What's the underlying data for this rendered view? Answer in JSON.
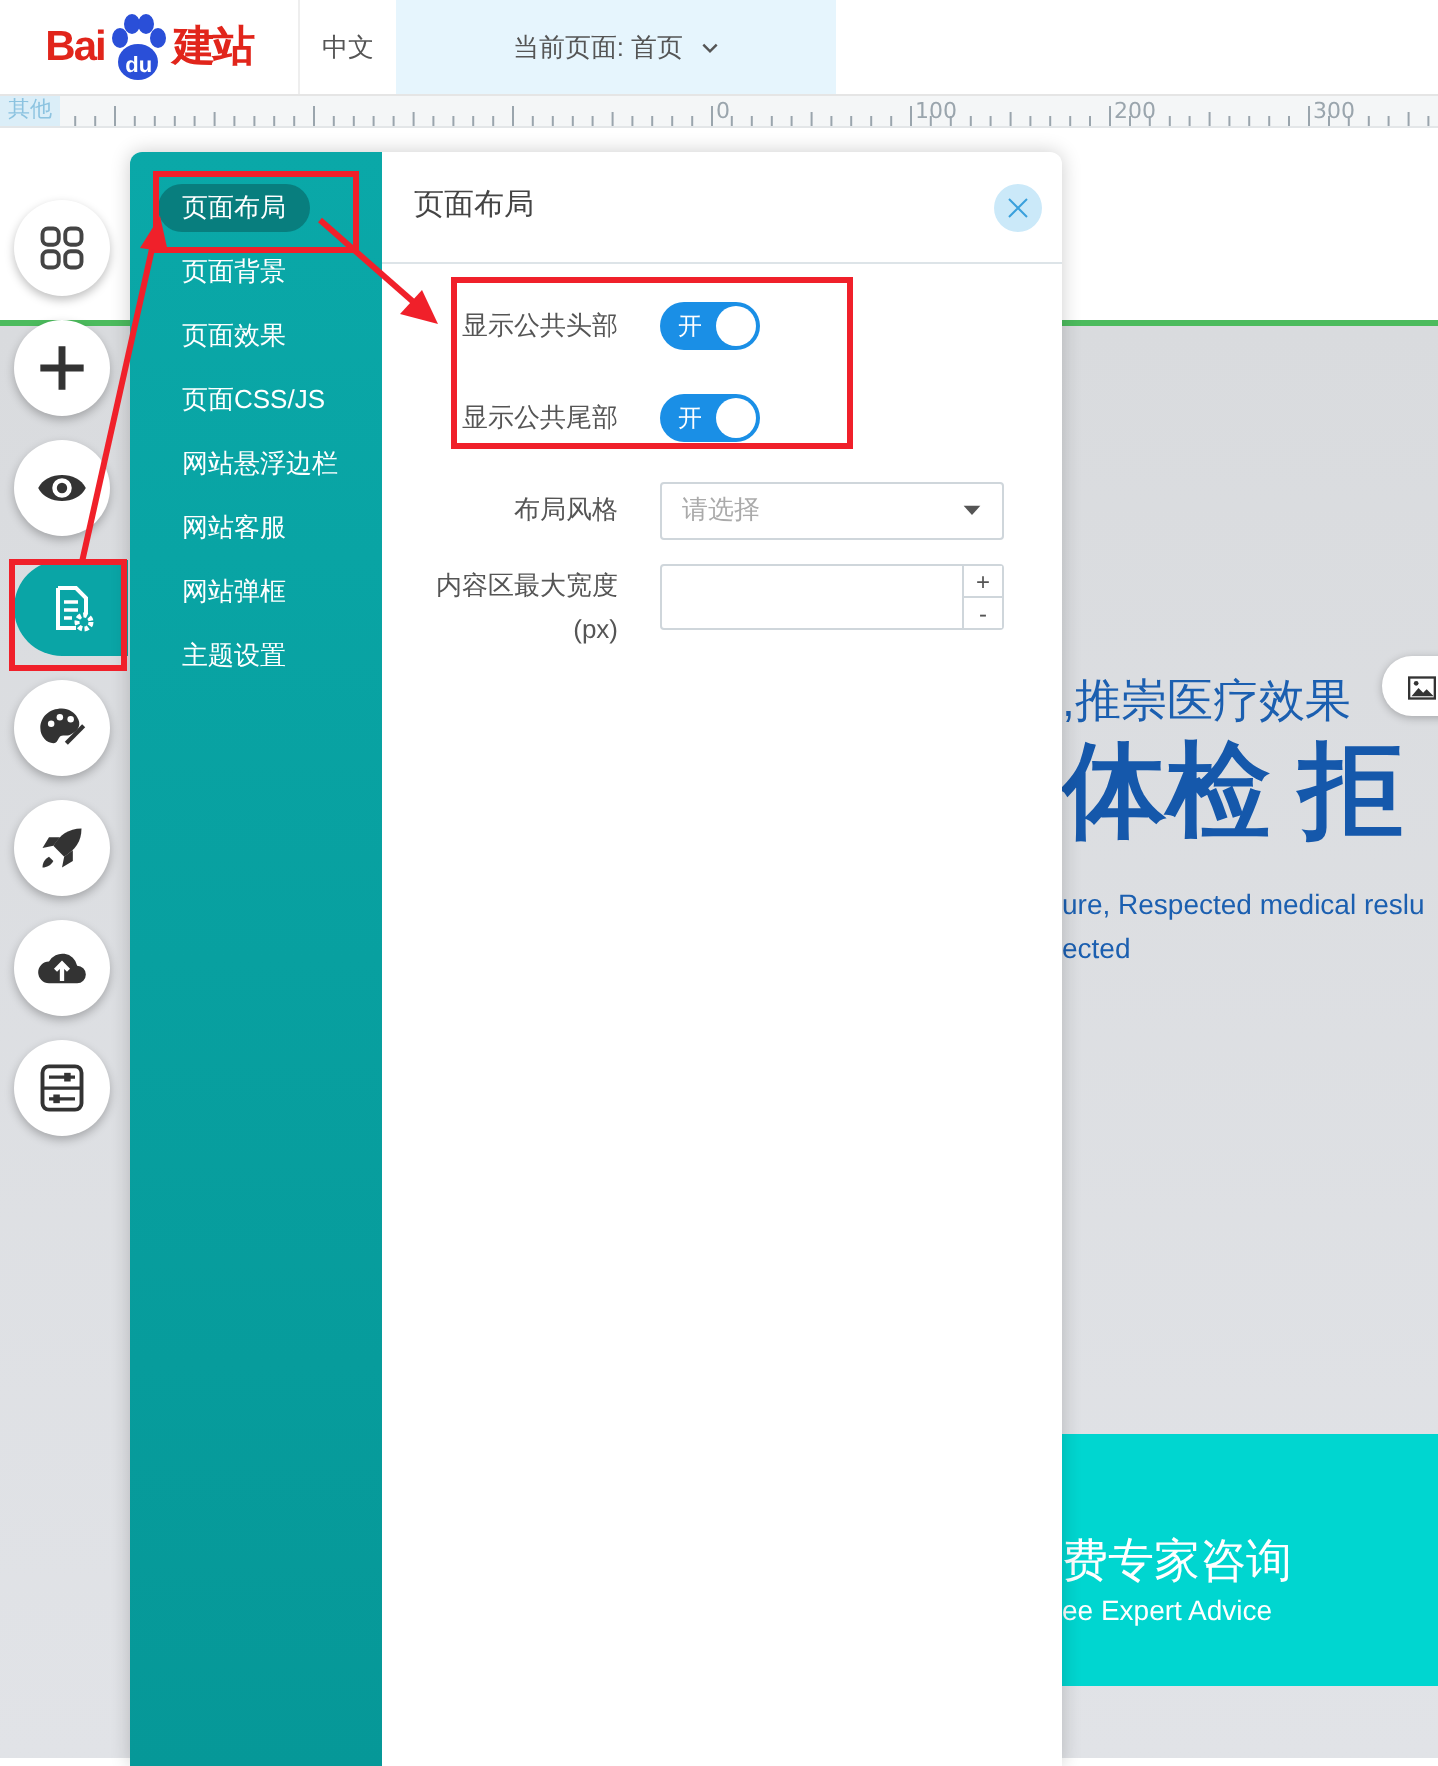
{
  "logo": {
    "left": "Bai",
    "paw": "du",
    "right": "建站"
  },
  "language_tab": {
    "label": "中文"
  },
  "page_selector": {
    "label": "当前页面: 首页"
  },
  "ruler": {
    "corner_label": "其他",
    "ticks": [
      "0",
      "100",
      "200",
      "300"
    ]
  },
  "tools": [
    {
      "kind": "grid",
      "selected": false
    },
    {
      "kind": "add",
      "selected": false
    },
    {
      "kind": "preview",
      "selected": false
    },
    {
      "kind": "page-settings",
      "selected": true
    },
    {
      "kind": "palette",
      "selected": false
    },
    {
      "kind": "rocket",
      "selected": false
    },
    {
      "kind": "upload",
      "selected": false
    },
    {
      "kind": "sliders",
      "selected": false
    }
  ],
  "panel": {
    "menu": [
      {
        "label": "页面布局",
        "selected": true
      },
      {
        "label": "页面背景",
        "selected": false
      },
      {
        "label": "页面效果",
        "selected": false
      },
      {
        "label": "页面CSS/JS",
        "selected": false
      },
      {
        "label": "网站悬浮边栏",
        "selected": false
      },
      {
        "label": "网站客服",
        "selected": false
      },
      {
        "label": "网站弹框",
        "selected": false
      },
      {
        "label": "主题设置",
        "selected": false
      }
    ],
    "title": "页面布局",
    "fields": [
      {
        "kind": "switch",
        "label": "显示公共头部",
        "on": true,
        "switch_text": "开"
      },
      {
        "kind": "switch",
        "label": "显示公共尾部",
        "on": true,
        "switch_text": "开"
      },
      {
        "kind": "select",
        "label": "布局风格",
        "placeholder": "请选择"
      },
      {
        "kind": "number",
        "label": "内容区最大宽度(px)",
        "plus": "+",
        "minus": "-"
      }
    ]
  },
  "canvas": {
    "tagline": ",推崇医疗效果",
    "headline": "体检 拒",
    "subtext_lines": [
      "ure, Respected medical reslu",
      "ected"
    ],
    "band_title": "费专家咨询",
    "band_subtitle": "ee Expert Advice"
  }
}
